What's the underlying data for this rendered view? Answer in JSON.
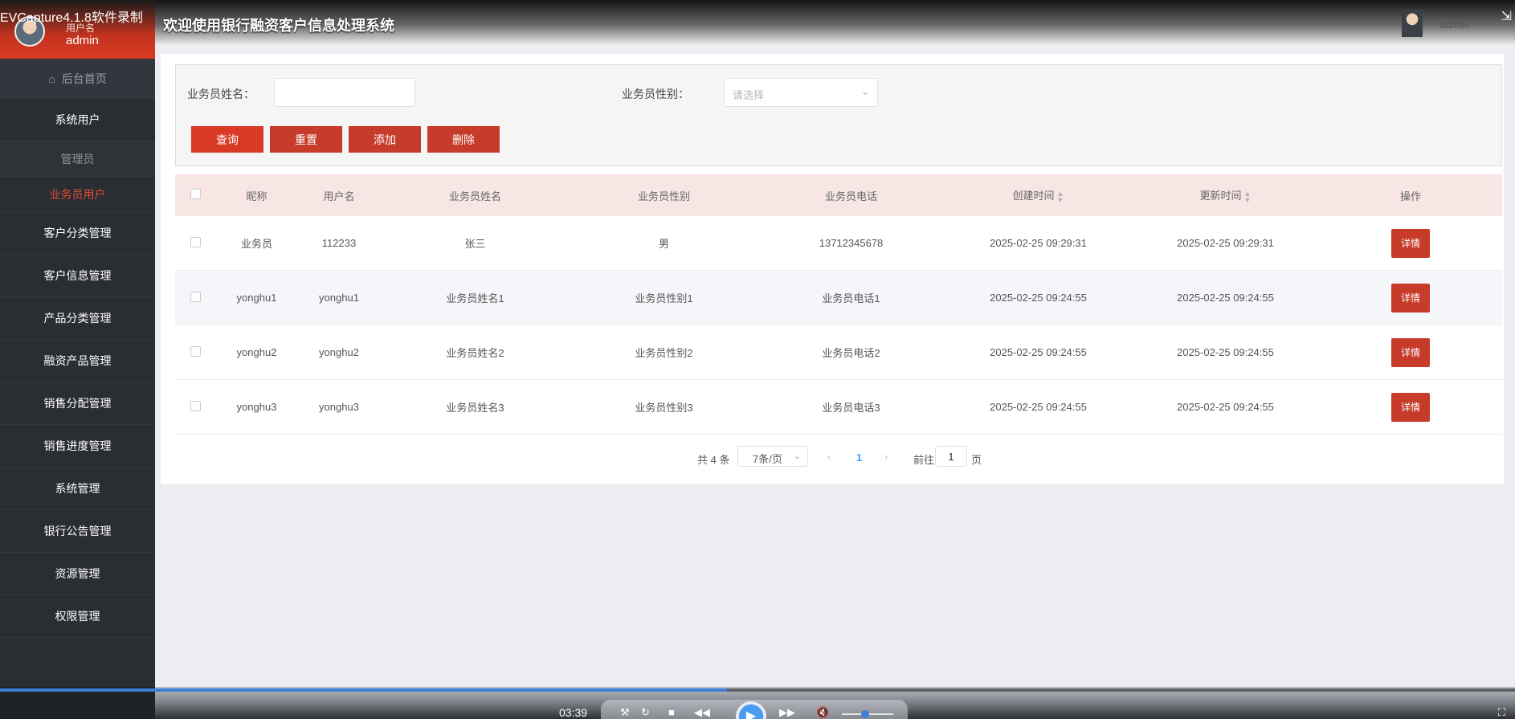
{
  "recorder": {
    "title": "EVCapture4.1.8软件录制"
  },
  "sidebar": {
    "user_label": "用户名",
    "user_name": "admin",
    "home_label": "后台首页",
    "items": [
      {
        "label": "系统用户"
      },
      {
        "label": "管理员"
      },
      {
        "label": "业务员用户"
      },
      {
        "label": "客户分类管理"
      },
      {
        "label": "客户信息管理"
      },
      {
        "label": "产品分类管理"
      },
      {
        "label": "融资产品管理"
      },
      {
        "label": "销售分配管理"
      },
      {
        "label": "销售进度管理"
      },
      {
        "label": "系统管理"
      },
      {
        "label": "银行公告管理"
      },
      {
        "label": "资源管理"
      },
      {
        "label": "权限管理"
      }
    ]
  },
  "header": {
    "title": "欢迎使用银行融资客户信息处理系统",
    "user": "admin"
  },
  "search": {
    "name_label": "业务员姓名：",
    "name_value": "",
    "gender_label": "业务员性别：",
    "gender_placeholder": "请选择",
    "buttons": {
      "query": "查询",
      "reset": "重置",
      "add": "添加",
      "delete": "删除"
    }
  },
  "table": {
    "columns": [
      "昵称",
      "用户名",
      "业务员姓名",
      "业务员性别",
      "业务员电话",
      "创建时间",
      "更新时间",
      "操作"
    ],
    "detail_label": "详情",
    "rows": [
      {
        "nickname": "业务员",
        "username": "112233",
        "name": "张三",
        "gender": "男",
        "phone": "13712345678",
        "created": "2025-02-25 09:29:31",
        "updated": "2025-02-25 09:29:31"
      },
      {
        "nickname": "yonghu1",
        "username": "yonghu1",
        "name": "业务员姓名1",
        "gender": "业务员性别1",
        "phone": "业务员电话1",
        "created": "2025-02-25 09:24:55",
        "updated": "2025-02-25 09:24:55"
      },
      {
        "nickname": "yonghu2",
        "username": "yonghu2",
        "name": "业务员姓名2",
        "gender": "业务员性别2",
        "phone": "业务员电话2",
        "created": "2025-02-25 09:24:55",
        "updated": "2025-02-25 09:24:55"
      },
      {
        "nickname": "yonghu3",
        "username": "yonghu3",
        "name": "业务员姓名3",
        "gender": "业务员性别3",
        "phone": "业务员电话3",
        "created": "2025-02-25 09:24:55",
        "updated": "2025-02-25 09:24:55"
      }
    ]
  },
  "pagination": {
    "total": "共 4 条",
    "page_size": "7条/页",
    "current_page": "1",
    "goto_label": "前往",
    "goto_value": "1",
    "page_unit": "页"
  },
  "player": {
    "time": "03:39",
    "progress": 0.48,
    "volume": 0.45
  },
  "colors": {
    "accent": "#c73b2a",
    "active_menu": "#e24a37",
    "sidebar": "#2a2d32"
  }
}
